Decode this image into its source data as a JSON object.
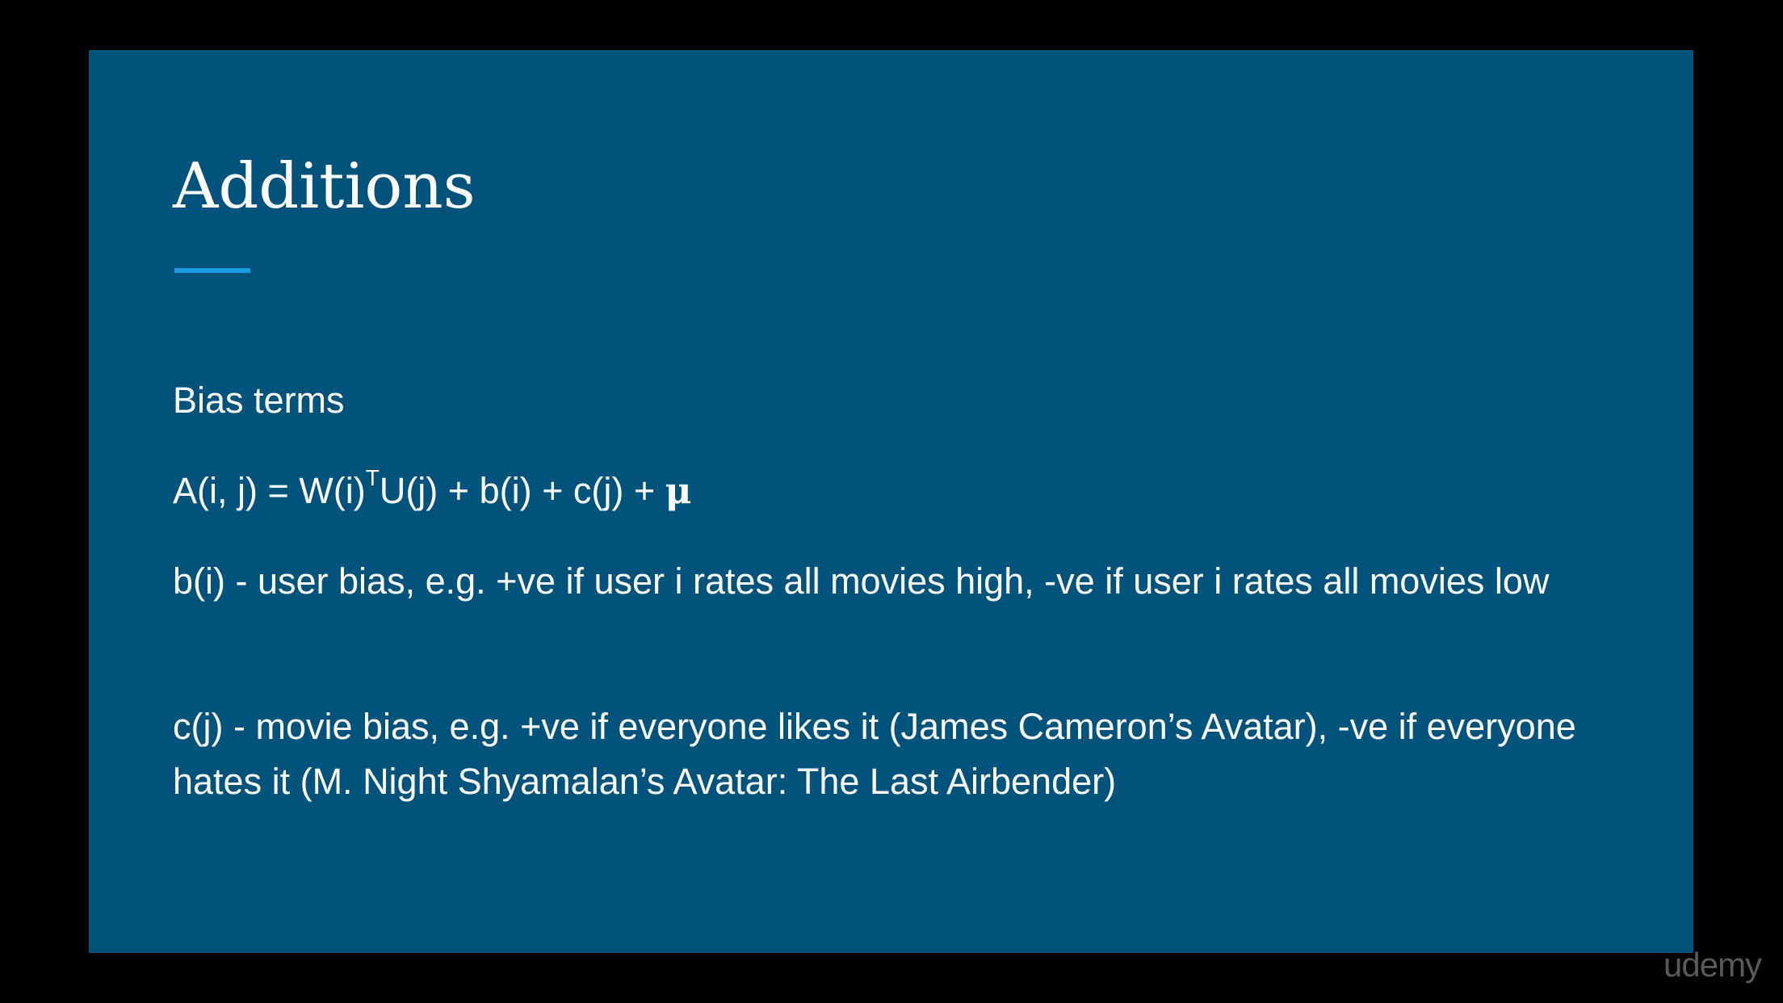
{
  "slide": {
    "title": "Additions",
    "bias_heading": "Bias terms",
    "formula": {
      "lhs_and_w": "A(i, j) = W(i)",
      "superscript": "T",
      "rest": "U(j) + b(i) + c(j) + ",
      "mu": "μ"
    },
    "user_bias": "b(i) - user bias, e.g. +ve if user i rates all movies high, -ve if user i rates all movies low",
    "movie_bias": "c(j) - movie bias, e.g. +ve if everyone likes it (James Cameron’s Avatar), -ve if everyone hates it (M. Night Shyamalan’s Avatar: The Last Airbender)"
  },
  "watermark": "udemy",
  "colors": {
    "background": "#000000",
    "slide_background": "#01537c",
    "accent_underline": "#1a9ae0",
    "text": "#ffffff",
    "watermark": "#5a5a5a"
  }
}
